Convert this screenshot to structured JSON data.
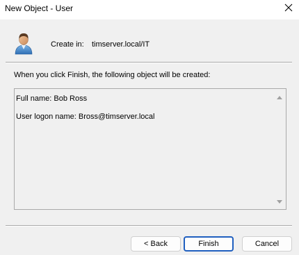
{
  "window": {
    "title": "New Object - User"
  },
  "header": {
    "create_in_label": "Create in:",
    "create_in_value": "timserver.local/IT"
  },
  "body": {
    "info_text": "When you click Finish, the following object will be created:",
    "summary_lines": [
      "Full name: Bob Ross",
      "User logon name: Bross@timserver.local"
    ]
  },
  "buttons": {
    "back": "< Back",
    "finish": "Finish",
    "cancel": "Cancel"
  },
  "icons": {
    "close": "close-icon",
    "user": "user-icon"
  },
  "colors": {
    "dialog_bg": "#f0f0f0",
    "titlebar_bg": "#ffffff",
    "default_button_border": "#1f5fbf"
  }
}
